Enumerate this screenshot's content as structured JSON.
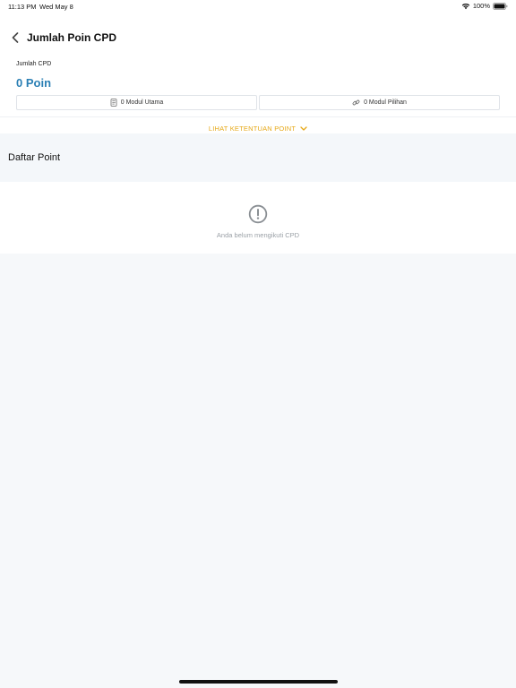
{
  "status_bar": {
    "time": "11:13 PM",
    "date": "Wed May 8",
    "battery": "100%"
  },
  "header": {
    "title": "Jumlah Poin CPD",
    "back_icon": "chevron-left-icon"
  },
  "summary": {
    "label": "Jumlah CPD",
    "value": "0 Poin",
    "value_color": "#2a7fb4",
    "modules": [
      {
        "icon": "document-icon",
        "label": "0 Modul Utama"
      },
      {
        "icon": "link-icon",
        "label": "0 Modul Pilihan"
      }
    ]
  },
  "rules_link": {
    "label": "LIHAT KETENTUAN POINT",
    "icon": "chevron-down-icon",
    "color": "#e6a817"
  },
  "list": {
    "title": "Daftar Point",
    "empty_icon": "exclamation-circle-icon",
    "empty_text": "Anda belum mengikuti CPD"
  }
}
